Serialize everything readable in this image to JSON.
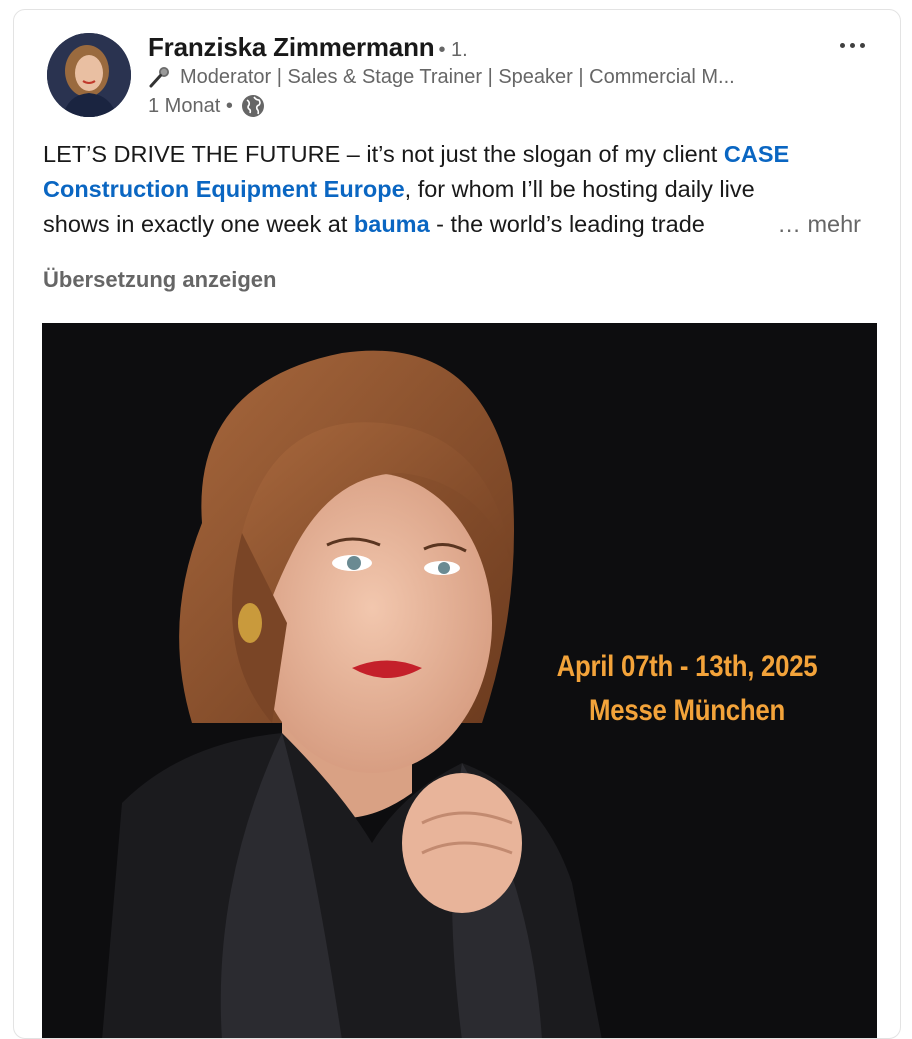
{
  "author": {
    "name": "Franziska Zimmermann",
    "degree": "• 1.",
    "headline": "Moderator | Sales & Stage Trainer | Speaker | Commercial M...",
    "headline_icon": "microphone-icon",
    "time": "1 Monat •",
    "visibility_icon": "globe-icon"
  },
  "post": {
    "line1_pre": "LET’S DRIVE THE FUTURE – it’s not just the slogan of my client ",
    "link_case": "CASE",
    "link_case_full": "Construction Equipment Europe",
    "line2_post": ", for whom I’ll be hosting daily live",
    "line3_pre": "shows in exactly one week at ",
    "link_bauma": "bauma",
    "line3_post": " - the world’s leading trade",
    "more_label": "… mehr",
    "translate_label": "Übersetzung anzeigen"
  },
  "image": {
    "date_text": "April 07th - 13th, 2025",
    "venue_text": "Messe München",
    "accent_color": "#f3a33a",
    "background_color": "#0d0d0f"
  },
  "colors": {
    "link": "#0a66c2",
    "secondary_text": "#666666"
  }
}
